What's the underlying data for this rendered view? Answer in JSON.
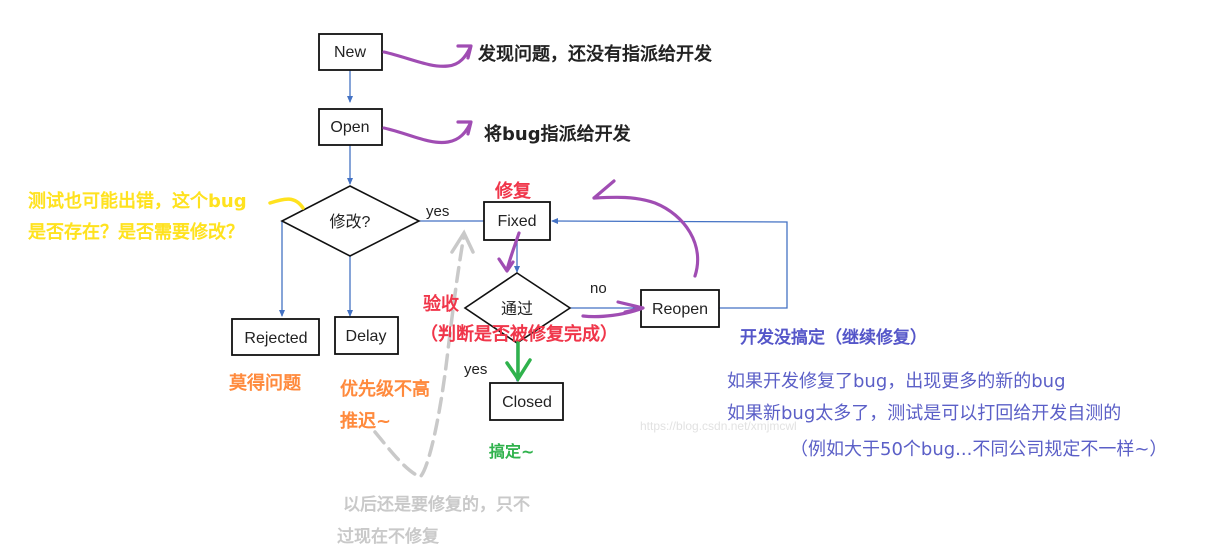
{
  "nodes": {
    "new": "New",
    "open": "Open",
    "modify_decision": "修改?",
    "fixed": "Fixed",
    "pass_decision": "通过",
    "reopen": "Reopen",
    "rejected": "Rejected",
    "delay": "Delay",
    "closed": "Closed"
  },
  "edge_labels": {
    "modify_yes": "yes",
    "pass_no": "no",
    "pass_yes": "yes"
  },
  "annotations": {
    "new_note": "发现问题，还没有指派给开发",
    "open_note": "将bug指派给开发",
    "tester_note_line1": "测试也可能出错，这个bug",
    "tester_note_line2": "是否存在？是否需要修改？",
    "fixed_note": "修复",
    "verify_note": "验收",
    "verify_detail": "（判断是否被修复完成）",
    "rejected_note": "莫得问题",
    "delay_note_line1": "优先级不高",
    "delay_note_line2": "推迟~",
    "closed_note": "搞定~",
    "delay_future_line1": "以后还是要修复的，只不",
    "delay_future_line2": "过现在不修复",
    "reopen_title": "开发没搞定（继续修复）",
    "reopen_line1": "如果开发修复了bug，出现更多的新的bug",
    "reopen_line2": "如果新bug太多了，测试是可以打回给开发自测的",
    "reopen_line3": "（例如大于50个bug...不同公司规定不一样~）"
  },
  "watermark": "https://blog.csdn.net/xmjmcwl",
  "colors": {
    "flow_line": "#4472c4",
    "annotation_arrow": "#a04db3",
    "yellow_note": "#ffe21f",
    "red_note": "#f0364a",
    "orange_note": "#ff8a3d",
    "green_note": "#2fb24c",
    "grey_note": "#c9c9c9",
    "blue_note": "#5556c9"
  }
}
